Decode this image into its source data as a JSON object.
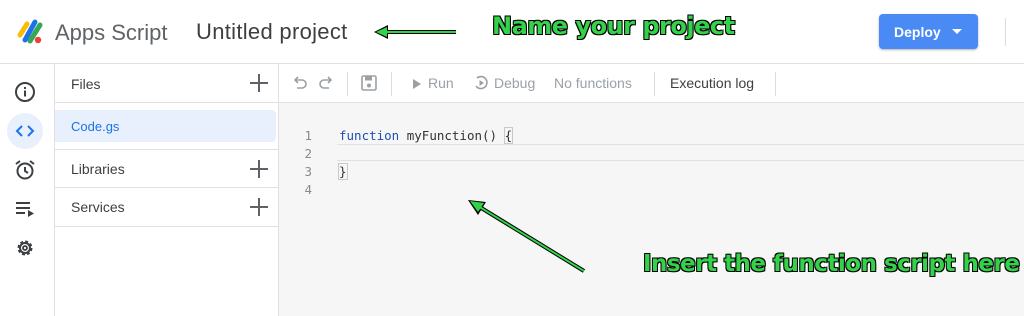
{
  "header": {
    "app_name": "Apps Script",
    "project_title": "Untitled project",
    "deploy_label": "Deploy"
  },
  "annotations": {
    "name_project": "Name your project",
    "insert_function": "Insert the function script here",
    "arrow_color": "#34d14a"
  },
  "rail": {
    "items": [
      {
        "icon": "info-icon"
      },
      {
        "icon": "code-icon",
        "active": true
      },
      {
        "icon": "alarm-clock-icon"
      },
      {
        "icon": "executions-icon"
      },
      {
        "icon": "gear-icon"
      }
    ]
  },
  "files_panel": {
    "files_label": "Files",
    "files": [
      "Code.gs"
    ],
    "libraries_label": "Libraries",
    "services_label": "Services"
  },
  "toolbar": {
    "undo_icon": "undo-icon",
    "redo_icon": "redo-icon",
    "save_icon": "save-icon",
    "run_label": "Run",
    "debug_label": "Debug",
    "function_select": "No functions",
    "execution_log_label": "Execution log"
  },
  "editor": {
    "line_numbers": [
      "1",
      "2",
      "3",
      "4"
    ],
    "keyword": "function",
    "function_signature": " myFunction() ",
    "open_brace": "{",
    "close_brace": "}"
  },
  "colors": {
    "accent": "#4a8af4",
    "active_bg": "#e8f0fe",
    "link": "#1a73e8"
  }
}
